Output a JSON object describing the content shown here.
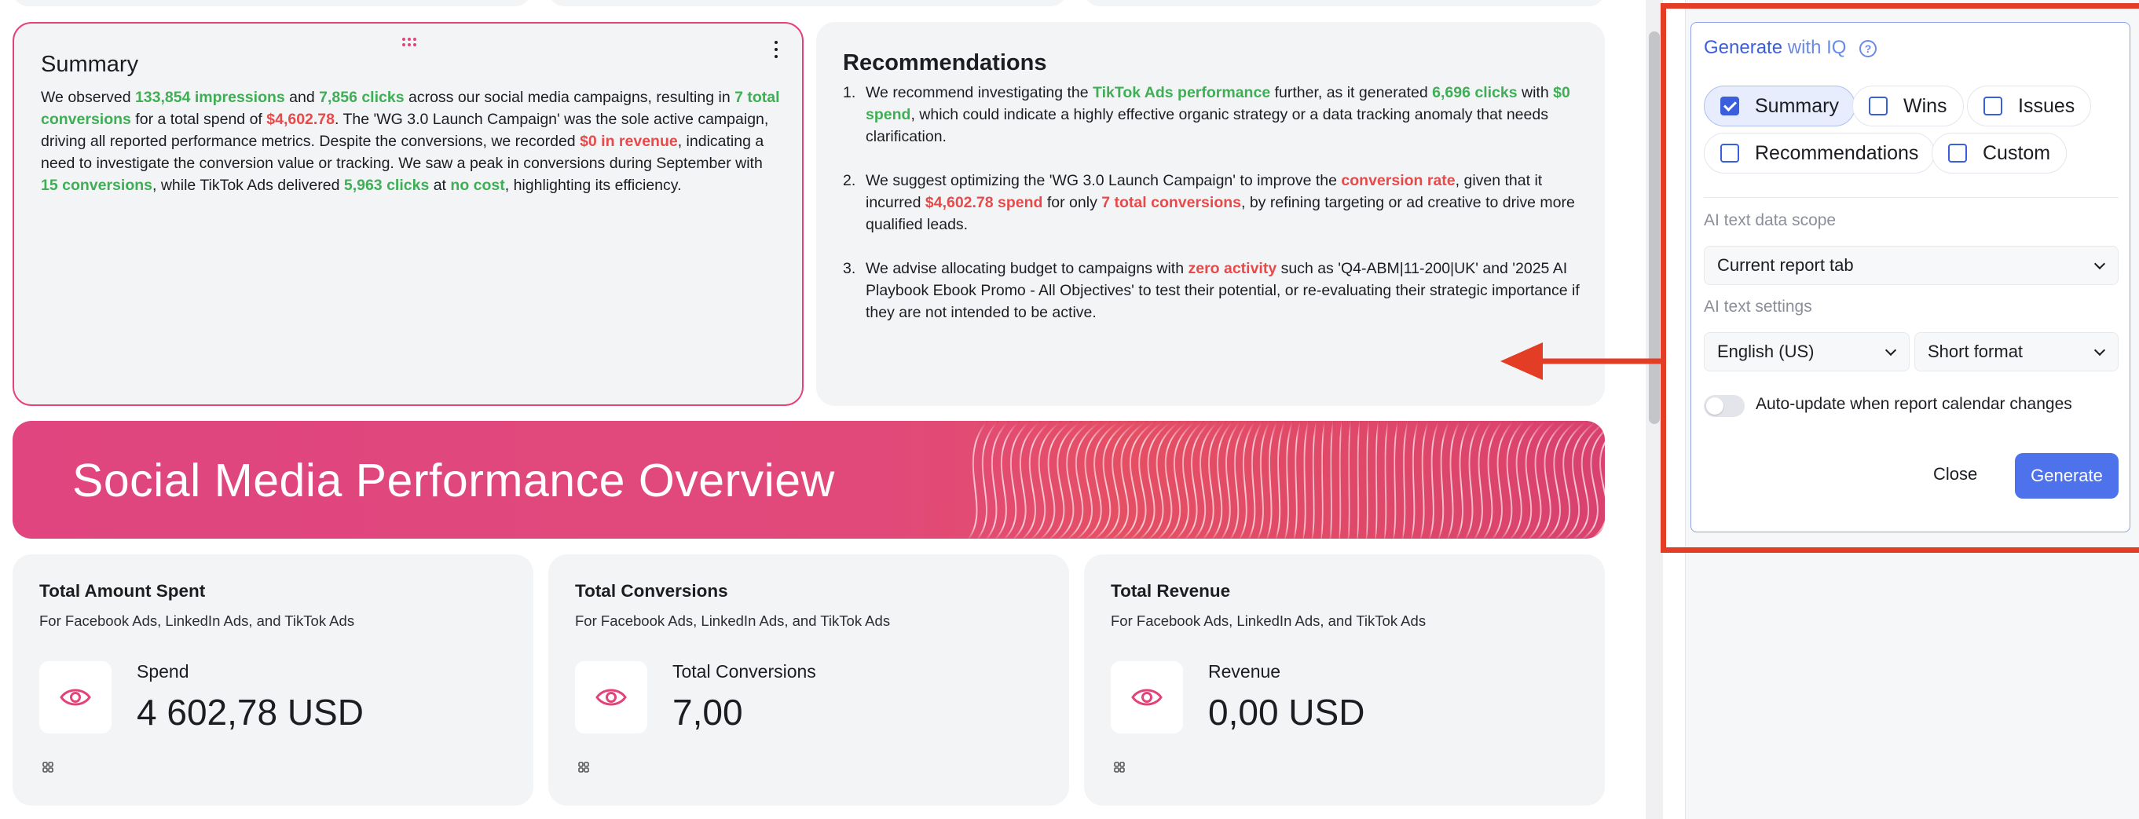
{
  "summary": {
    "title": "Summary",
    "paragraph": [
      {
        "t": "We observed ",
        "c": ""
      },
      {
        "t": "133,854 impressions",
        "c": "g"
      },
      {
        "t": " and ",
        "c": ""
      },
      {
        "t": "7,856 clicks",
        "c": "g"
      },
      {
        "t": " across our social media campaigns, resulting in ",
        "c": ""
      },
      {
        "t": "7 total conversions",
        "c": "g"
      },
      {
        "t": " for a total spend of ",
        "c": ""
      },
      {
        "t": "$4,602.78",
        "c": "r"
      },
      {
        "t": ". The 'WG 3.0 Launch Campaign' was the sole active campaign, driving all reported performance metrics. Despite the conversions, we recorded ",
        "c": ""
      },
      {
        "t": "$0 in revenue",
        "c": "r"
      },
      {
        "t": ", indicating a need to investigate the conversion value or tracking. We saw a peak in conversions during September with ",
        "c": ""
      },
      {
        "t": "15 conversions",
        "c": "g"
      },
      {
        "t": ", while TikTok Ads delivered ",
        "c": ""
      },
      {
        "t": "5,963 clicks",
        "c": "g"
      },
      {
        "t": " at ",
        "c": ""
      },
      {
        "t": "no cost",
        "c": "g"
      },
      {
        "t": ", highlighting its efficiency.",
        "c": ""
      }
    ]
  },
  "recommendations": {
    "title": "Recommendations",
    "items": [
      {
        "num": "1.",
        "parts": [
          {
            "t": "We recommend investigating the ",
            "c": ""
          },
          {
            "t": "TikTok Ads performance",
            "c": "g"
          },
          {
            "t": " further, as it generated ",
            "c": ""
          },
          {
            "t": "6,696 clicks",
            "c": "g"
          },
          {
            "t": " with ",
            "c": ""
          },
          {
            "t": "$0 spend",
            "c": "g"
          },
          {
            "t": ", which could indicate a highly effective organic strategy or a data tracking anomaly that needs clarification.",
            "c": ""
          }
        ]
      },
      {
        "num": "2.",
        "parts": [
          {
            "t": "We suggest optimizing the 'WG 3.0 Launch Campaign' to improve the ",
            "c": ""
          },
          {
            "t": "conversion rate",
            "c": "r"
          },
          {
            "t": ", given that it incurred ",
            "c": ""
          },
          {
            "t": "$4,602.78 spend",
            "c": "r"
          },
          {
            "t": " for only ",
            "c": ""
          },
          {
            "t": "7 total conversions",
            "c": "r"
          },
          {
            "t": ", by refining targeting or ad creative to drive more qualified leads.",
            "c": ""
          }
        ]
      },
      {
        "num": "3.",
        "parts": [
          {
            "t": "We advise allocating budget to campaigns with ",
            "c": ""
          },
          {
            "t": "zero activity",
            "c": "r"
          },
          {
            "t": " such as 'Q4-ABM|11-200|UK' and '2025 AI Playbook Ebook Promo - All Objectives' to test their potential, or re-evaluating their strategic importance if they are not intended to be active.",
            "c": ""
          }
        ]
      }
    ]
  },
  "banner": {
    "title": "Social Media Performance Overview"
  },
  "kpis": [
    {
      "title": "Total Amount Spent",
      "subtitle": "For Facebook Ads, LinkedIn Ads, and TikTok Ads",
      "label": "Spend",
      "value": "4 602,78 USD",
      "icon": "eye-icon"
    },
    {
      "title": "Total Conversions",
      "subtitle": "For Facebook Ads, LinkedIn Ads, and TikTok Ads",
      "label": "Total Conversions",
      "value": "7,00",
      "icon": "eye-icon"
    },
    {
      "title": "Total Revenue",
      "subtitle": "For Facebook Ads, LinkedIn Ads, and TikTok Ads",
      "label": "Revenue",
      "value": "0,00 USD",
      "icon": "eye-icon"
    }
  ],
  "popup": {
    "title_generate": "Generate",
    "title_with": " with IQ",
    "help_icon": "?",
    "chips": [
      {
        "label": "Summary",
        "checked": true
      },
      {
        "label": "Wins",
        "checked": false
      },
      {
        "label": "Issues",
        "checked": false
      },
      {
        "label": "Recommendations",
        "checked": false
      },
      {
        "label": "Custom",
        "checked": false
      }
    ],
    "scope_label": "AI text data scope",
    "scope_value": "Current report tab",
    "settings_label": "AI text settings",
    "language_value": "English (US)",
    "format_value": "Short format",
    "auto_update_label": "Auto-update when report calendar changes",
    "auto_update_on": false,
    "close_label": "Close",
    "generate_label": "Generate"
  },
  "colors": {
    "accent_pink": "#e2447a",
    "positive_green": "#3fae55",
    "negative_red": "#e64a4a",
    "primary_blue": "#4d72ec",
    "highlight_red": "#e43d25"
  }
}
